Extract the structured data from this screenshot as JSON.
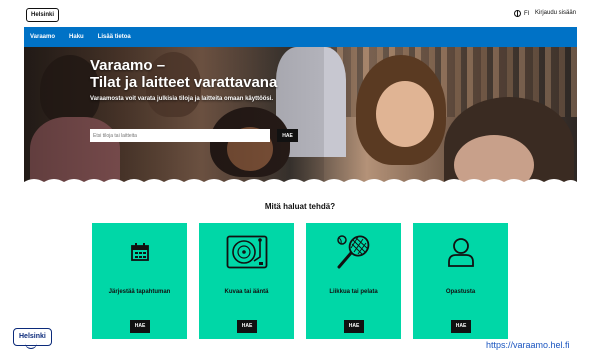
{
  "header": {
    "logo_text": "Helsinki",
    "language": "FI",
    "login": "Kirjaudu sisään"
  },
  "nav": {
    "items": [
      {
        "label": "Varaamo"
      },
      {
        "label": "Haku"
      },
      {
        "label": "Lisää tietoa"
      }
    ]
  },
  "hero": {
    "title_line1": "Varaamo –",
    "title_line2": "Tilat ja laitteet varattavana",
    "subtitle": "Varaamosta voit varata julkisia tiloja ja laitteita omaan käyttöösi.",
    "search_placeholder": "Etsi tiloja tai laitteita",
    "search_button": "HAE"
  },
  "main": {
    "question": "Mitä haluat tehdä?",
    "cards": [
      {
        "label": "Järjestää tapahtuman",
        "button": "HAE",
        "icon": "calendar-icon"
      },
      {
        "label": "Kuvaa tai ääntä",
        "button": "HAE",
        "icon": "turntable-icon"
      },
      {
        "label": "Liikkua tai pelata",
        "button": "HAE",
        "icon": "tennis-icon"
      },
      {
        "label": "Opastusta",
        "button": "HAE",
        "icon": "person-icon"
      }
    ]
  },
  "footer": {
    "logo_text": "Helsinki",
    "url": "https://varaamo.hel.fi"
  },
  "colors": {
    "nav_blue": "#0072c6",
    "card_green": "#00d7a7",
    "button_black": "#111111"
  }
}
